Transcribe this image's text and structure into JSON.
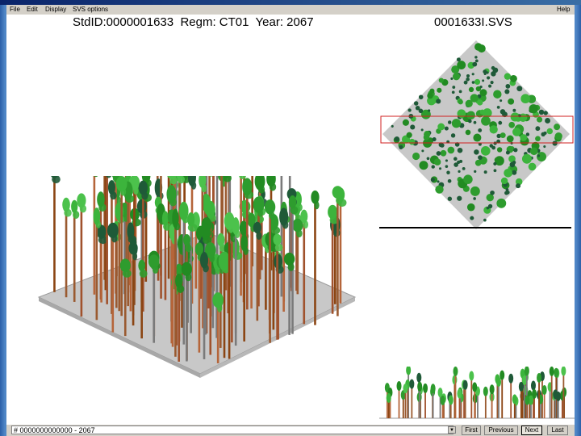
{
  "menu": {
    "file": "File",
    "edit": "Edit",
    "display": "Display",
    "svs_options": "SVS options",
    "help": "Help"
  },
  "header": {
    "stand": "StdID:0000001633  Regm: CT01  Year: 2067",
    "file": "0001633I.SVS"
  },
  "status": {
    "field_value": "# 0000000000000 - 2067",
    "buttons": {
      "first": "First",
      "previous": "Previous",
      "next": "Next",
      "last": "Last"
    }
  },
  "colors": {
    "plot_fill": "#c8c8c8",
    "foliage": "#2e9c2e",
    "dark_foliage": "#1f5a38",
    "trunk": "#a0522d",
    "selection_rect": "#d02020"
  }
}
